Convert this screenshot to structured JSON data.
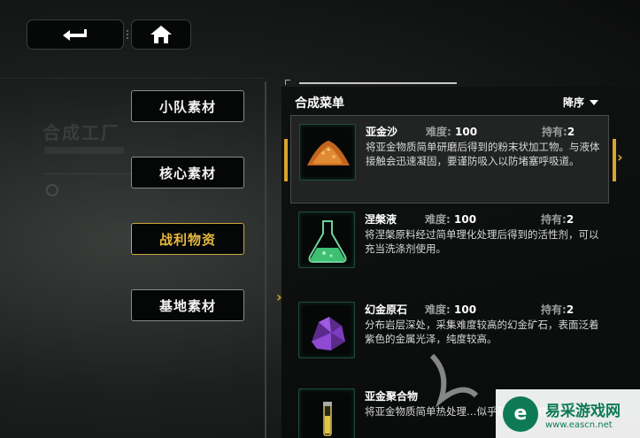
{
  "nav": {
    "back_icon": "back-arrow-icon",
    "home_icon": "home-icon"
  },
  "categories": [
    {
      "label": "小队素材",
      "active": false
    },
    {
      "label": "核心素材",
      "active": false
    },
    {
      "label": "战利物资",
      "active": true
    },
    {
      "label": "基地素材",
      "active": false
    }
  ],
  "background": {
    "title": "合成工厂"
  },
  "panel": {
    "title": "合成菜单",
    "sort_label": "降序",
    "difficulty_label": "难度:",
    "hold_label": "持有:",
    "items": [
      {
        "name": "亚金沙",
        "difficulty": "100",
        "hold": "2",
        "icon": "sand-pile-icon",
        "desc": "将亚金物质简单研磨后得到的粉末状加工物。与液体接触会迅速凝固，要谨防吸入以防堵塞呼吸道。",
        "selected": true
      },
      {
        "name": "涅槃液",
        "difficulty": "100",
        "hold": "2",
        "icon": "flask-icon",
        "desc": "将涅槃原料经过简单理化处理后得到的活性剂，可以充当洗涤剂使用。",
        "selected": false
      },
      {
        "name": "幻金原石",
        "difficulty": "100",
        "hold": "2",
        "icon": "crystal-ore-icon",
        "desc": "分布岩层深处，采集难度较高的幻金矿石，表面泛着紫色的金属光泽，纯度较高。",
        "selected": false
      },
      {
        "name": "亚金聚合物",
        "difficulty": "",
        "hold": "",
        "icon": "vial-icon",
        "desc": "将亚金物质简单热处理…似乎蕴藏着异样的能…",
        "selected": false
      }
    ]
  },
  "watermark": {
    "name": "易采游戏网",
    "url": "www.eascn.net"
  },
  "colors": {
    "accent": "#d9a42f",
    "panel_bg": "#0e1010"
  }
}
